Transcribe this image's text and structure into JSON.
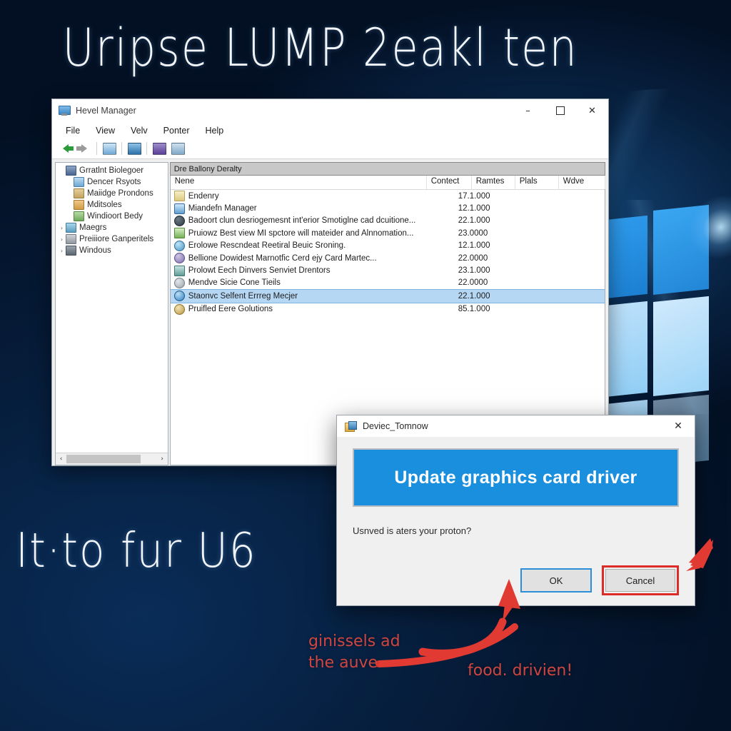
{
  "overlay": {
    "title_scribble": "Uripse LUMP 2eakl ten",
    "bottom_scribble": "It·to fur U6",
    "note_left": "ginissels ad\nthe auve",
    "note_right": "food. drivien!",
    "scribble_color": "#f2f6fa",
    "note_color": "#cf4640"
  },
  "window": {
    "title": "Hevel Manager",
    "controls": {
      "minimize": "–",
      "maximize": "☐",
      "close": "✕"
    },
    "menus": [
      "File",
      "View",
      "Velv",
      "Ponter",
      "Help"
    ],
    "toolbar": [
      {
        "icon": "back-arrow-icon"
      },
      {
        "icon": "forward-arrow-icon"
      },
      {
        "icon": "computer-icon"
      },
      {
        "icon": "properties-icon"
      },
      {
        "icon": "update-driver-icon"
      },
      {
        "icon": "scan-hardware-icon"
      }
    ]
  },
  "tree": {
    "items": [
      {
        "label": "Grratlnt Biolegoer",
        "indent": 0,
        "twisty": "",
        "icon": "root-computer-icon"
      },
      {
        "label": "Dencer Rsyots",
        "indent": 1,
        "twisty": "",
        "icon": "folder-blue-icon"
      },
      {
        "label": "Maiidge Prondons",
        "indent": 1,
        "twisty": "",
        "icon": "folder-tan-icon"
      },
      {
        "label": "Mditsoles",
        "indent": 1,
        "twisty": "",
        "icon": "folder-orange-icon"
      },
      {
        "label": "Windioort Bedy",
        "indent": 1,
        "twisty": "",
        "icon": "folder-green-icon"
      },
      {
        "label": "Maegrs",
        "indent": 0,
        "twisty": "›",
        "icon": "folder-cyan-icon"
      },
      {
        "label": "Preiiiore Ganperitels",
        "indent": 0,
        "twisty": "›",
        "icon": "folder-gray-icon"
      },
      {
        "label": "Windous",
        "indent": 0,
        "twisty": "›",
        "icon": "folder-dark-icon"
      }
    ]
  },
  "list": {
    "banner": "Dre Ballony Deralty",
    "columns": [
      "Nene",
      "Contect",
      "Ramtes",
      "Plals",
      "Wdve",
      ""
    ],
    "rows": [
      {
        "name": "Endenry",
        "icon": "document-icon",
        "value": "17.1.000",
        "selected": false
      },
      {
        "name": "Miandefn Manager",
        "icon": "monitor-icon",
        "value": "12.1.000",
        "selected": false
      },
      {
        "name": "Badoort clun desriogemesnt int'erior Smotiglne cad dcuitione...",
        "icon": "disc-dark-icon",
        "value": "22.1.000",
        "selected": false
      },
      {
        "name": "Pruiowz Best view MI spctore will mateider and Alnnomation...",
        "icon": "chart-green-icon",
        "value": "23.0000",
        "selected": false
      },
      {
        "name": "Erolowe Rescndeat Reetiral Beuic Sroning.",
        "icon": "disc-cyan-icon",
        "value": "12.1.000",
        "selected": false
      },
      {
        "name": "Bellione Dowidest Marnotfic Cerd ejy Card Martec...",
        "icon": "disc-purple-icon",
        "value": "22.0000",
        "selected": false
      },
      {
        "name": "Prolowt Eech Dinvers Senviet Drentors",
        "icon": "disc-teal-icon",
        "value": "23.1.000",
        "selected": false
      },
      {
        "name": "Mendve Sicie Cone Tieils",
        "icon": "disc-silver-icon",
        "value": "22.0000",
        "selected": false
      },
      {
        "name": "Staonvc Selfent Errreg Mecjer",
        "icon": "disc-blue-icon",
        "value": "22.1.000",
        "selected": true
      },
      {
        "name": "Pruifled Eere Golutions",
        "icon": "disc-gold-icon",
        "value": "85.1.000",
        "selected": false
      }
    ],
    "hscroll": {
      "left": "‹",
      "right": "›"
    }
  },
  "dialog": {
    "title": "Deviec_Tomnow",
    "close_label": "✕",
    "banner_text": "Update graphics card driver",
    "banner_color": "#1a8fdd",
    "message": "Usnved is aters your proton?",
    "ok_label": "OK",
    "cancel_label": "Cancel",
    "ok_focus_color": "#2a8fd8",
    "cancel_highlight_color": "#dd2b28"
  }
}
